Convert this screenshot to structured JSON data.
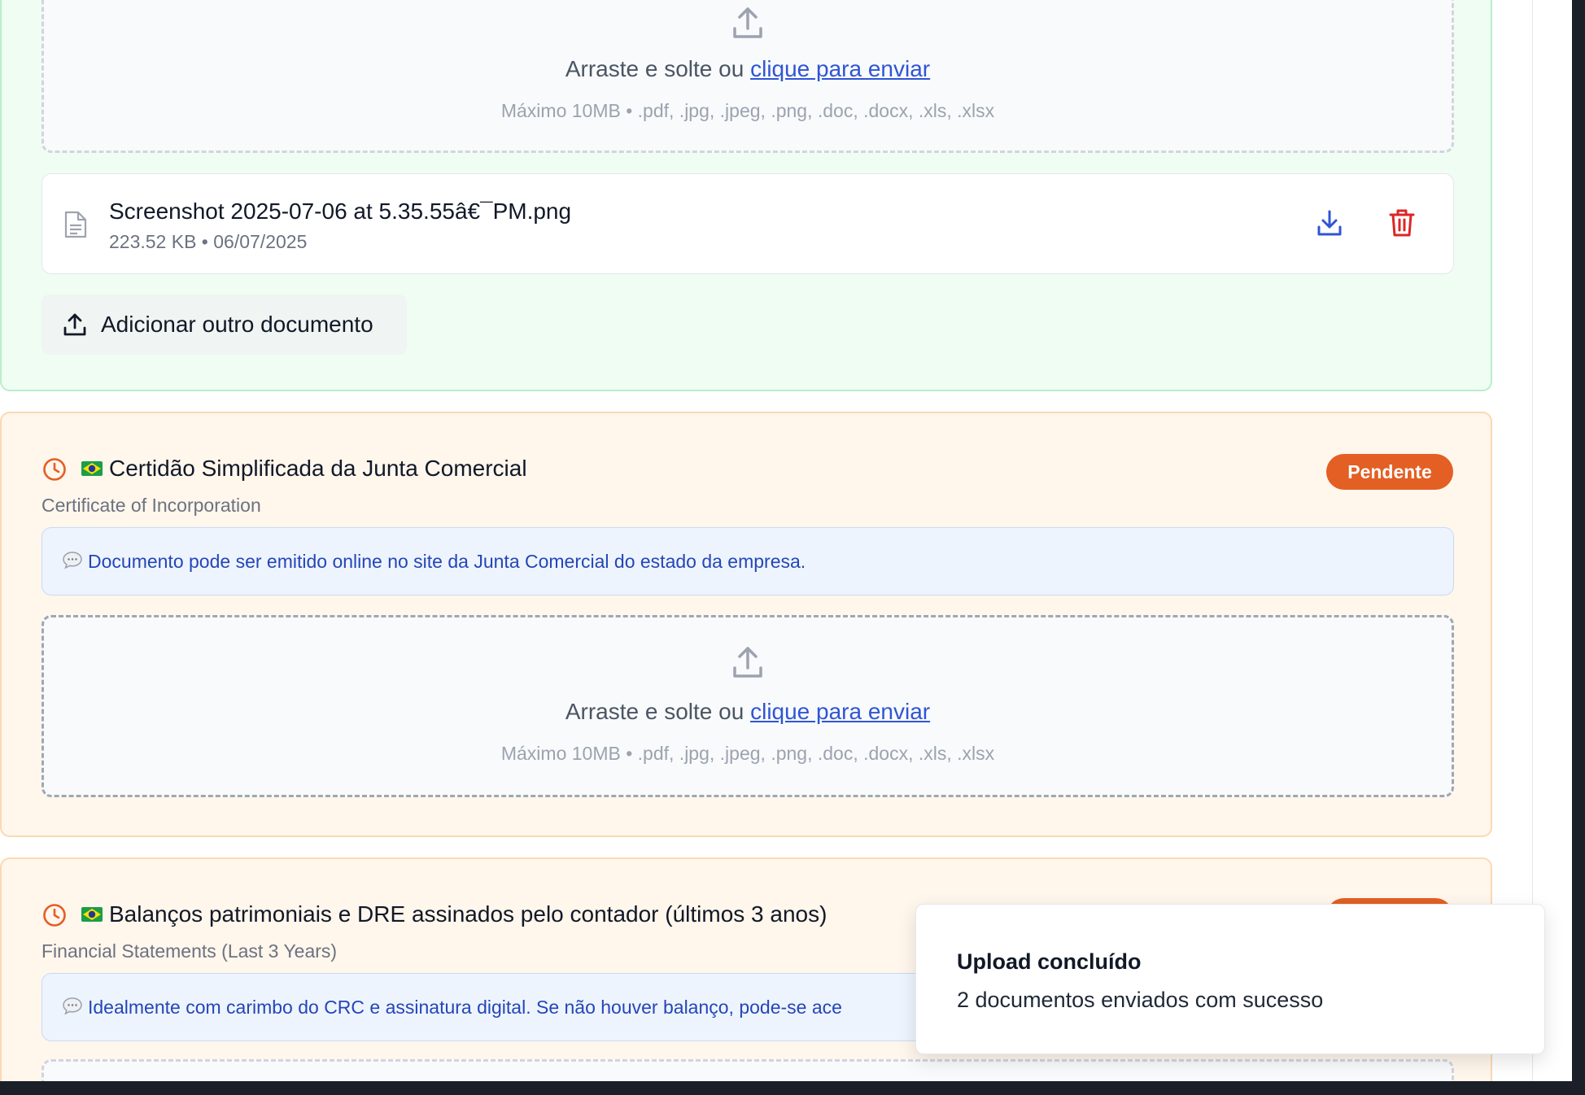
{
  "dropzone": {
    "text": "Arraste e solte ou",
    "link": "clique para enviar",
    "hint": "Máximo 10MB • .pdf, .jpg, .jpeg, .png, .doc, .docx, .xls, .xlsx"
  },
  "completed_document": {
    "file": {
      "name": "Screenshot 2025-07-06 at 5.35.55â€¯PM.png",
      "meta": "223.52 KB • 06/07/2025"
    },
    "add_button_label": "Adicionar outro documento"
  },
  "documents": [
    {
      "title": "Certidão Simplificada da Junta Comercial",
      "subtitle": "Certificate of Incorporation",
      "status": "Pendente",
      "note": "Documento pode ser emitido online no site da Junta Comercial do estado da empresa."
    },
    {
      "title": "Balanços patrimoniais e DRE assinados pelo contador (últimos 3 anos)",
      "subtitle": "Financial Statements (Last 3 Years)",
      "note": "Idealmente com carimbo do CRC e assinatura digital. Se não houver balanço, pode-se ace"
    }
  ],
  "toast": {
    "title": "Upload concluído",
    "description": "2 documentos enviados com sucesso"
  },
  "colors": {
    "completed_bg": "#effdf3",
    "pending_bg": "#fff6ec",
    "badge": "#e35f24",
    "link": "#2f55d4",
    "note_text": "#2446b8",
    "delete": "#dc2626"
  },
  "icons": [
    "upload-icon",
    "file-icon",
    "download-icon",
    "trash-icon",
    "clock-icon",
    "brazil-flag-icon",
    "speech-bubble-icon"
  ]
}
